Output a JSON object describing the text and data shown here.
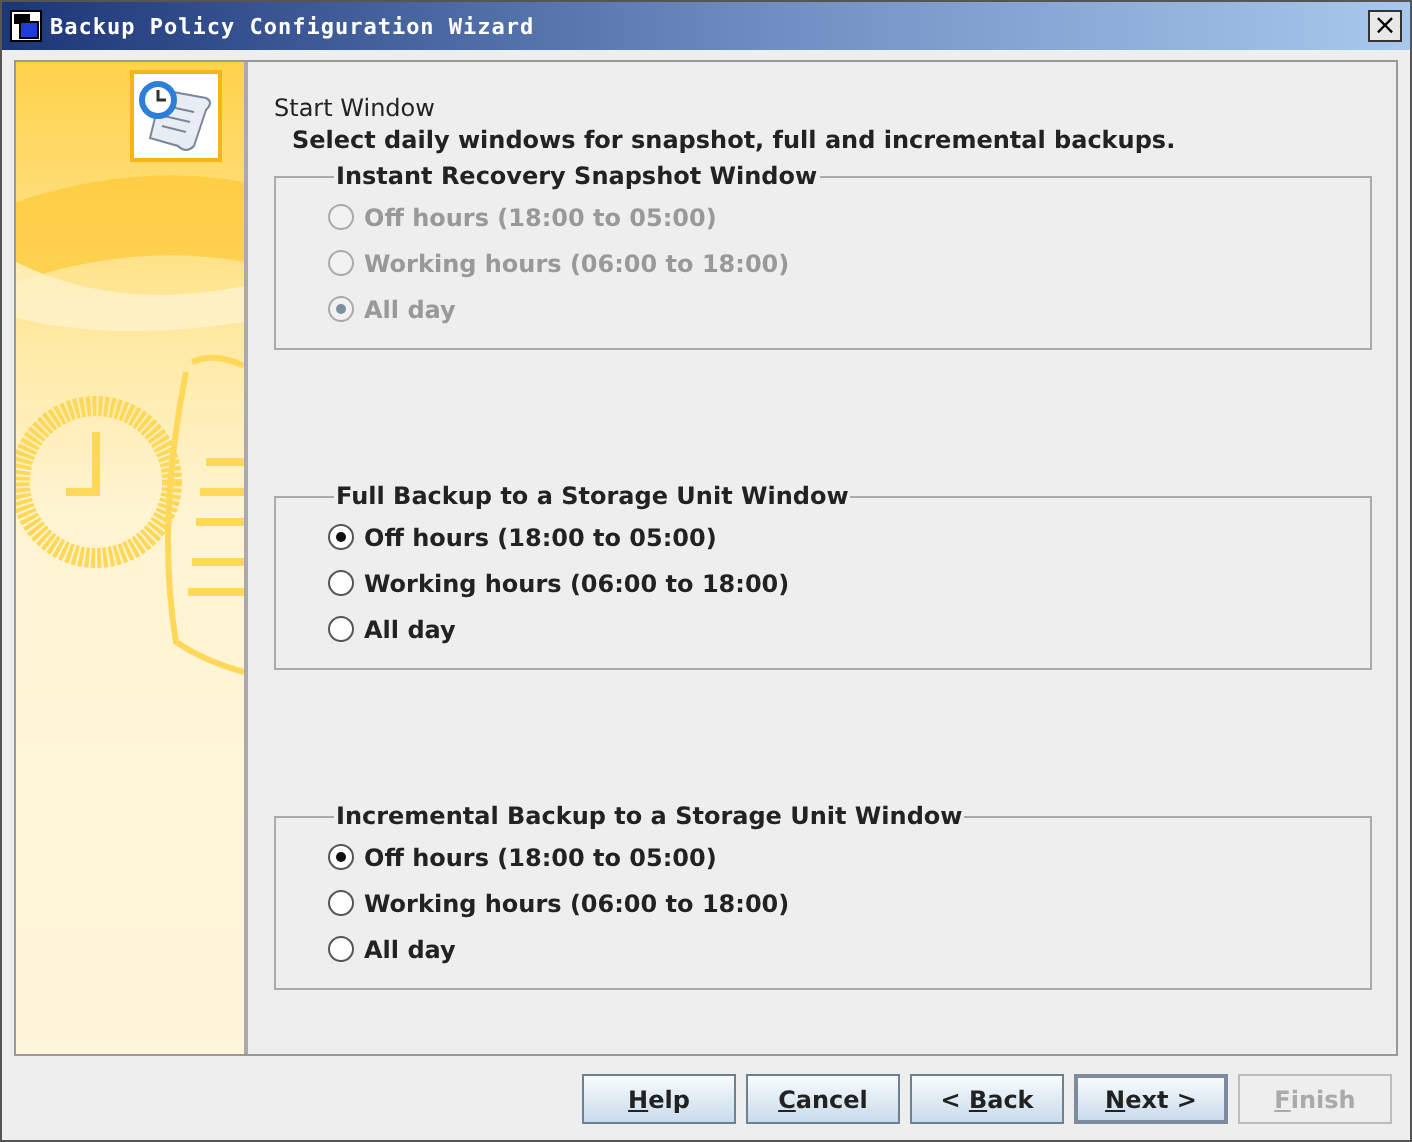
{
  "window": {
    "title": "Backup Policy Configuration Wizard",
    "close": "×"
  },
  "header": {
    "title": "Start Window",
    "description": "Select daily windows for snapshot, full and incremental backups."
  },
  "groups": [
    {
      "title": "Instant Recovery Snapshot Window",
      "disabled": true,
      "options": [
        {
          "label": "Off hours (18:00 to 05:00)",
          "selected": false
        },
        {
          "label": "Working hours (06:00 to 18:00)",
          "selected": false
        },
        {
          "label": "All day",
          "selected": true
        }
      ]
    },
    {
      "title": "Full Backup to a Storage Unit Window",
      "disabled": false,
      "options": [
        {
          "label": "Off hours (18:00 to 05:00)",
          "selected": true
        },
        {
          "label": "Working hours (06:00 to 18:00)",
          "selected": false
        },
        {
          "label": "All day",
          "selected": false
        }
      ]
    },
    {
      "title": "Incremental Backup to a Storage Unit Window",
      "disabled": false,
      "options": [
        {
          "label": "Off hours (18:00 to 05:00)",
          "selected": true
        },
        {
          "label": "Working hours (06:00 to 18:00)",
          "selected": false
        },
        {
          "label": "All day",
          "selected": false
        }
      ]
    }
  ],
  "buttons": [
    {
      "key": "H",
      "after": "elp",
      "default": false,
      "disabled": false
    },
    {
      "key": "C",
      "after": "ancel",
      "default": false,
      "disabled": false
    },
    {
      "before": "< ",
      "key": "B",
      "after": "ack",
      "default": false,
      "disabled": false
    },
    {
      "key": "N",
      "after": "ext >",
      "default": true,
      "disabled": false
    },
    {
      "key": "F",
      "after": "inish",
      "default": false,
      "disabled": true
    }
  ]
}
